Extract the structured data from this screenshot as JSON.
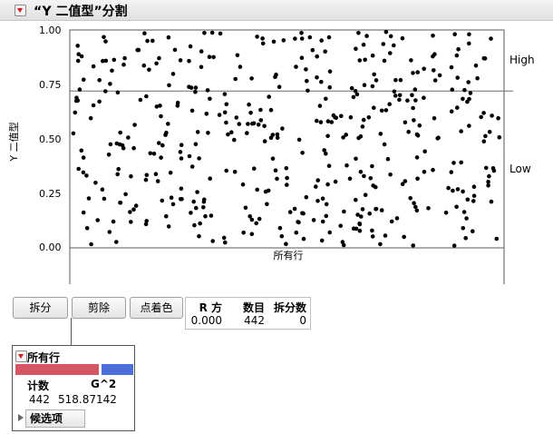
{
  "header": {
    "title": "“Y 二值型”分割"
  },
  "plot": {
    "y_axis_label": "Y 二值型",
    "y_ticks": [
      "1.00",
      "0.75",
      "0.50",
      "0.25",
      "0.00"
    ],
    "x_category": "所有行",
    "segments": {
      "upper": "High",
      "lower": "Low"
    },
    "split_value": 0.72
  },
  "buttons": {
    "split": "拆分",
    "prune": "剪除",
    "color_points": "点着色"
  },
  "stats": {
    "headers": [
      "R 方",
      "数目",
      "拆分数"
    ],
    "values": [
      "0.000",
      "442",
      "0"
    ]
  },
  "node": {
    "title": "所有行",
    "share_high": 0.275,
    "col_headers": [
      "计数",
      "G^2"
    ],
    "count": "442",
    "g2": "518.87142",
    "candidates_label": "候选项"
  },
  "colors": {
    "accent_red": "#d65563",
    "accent_blue": "#4b6ed9"
  }
}
